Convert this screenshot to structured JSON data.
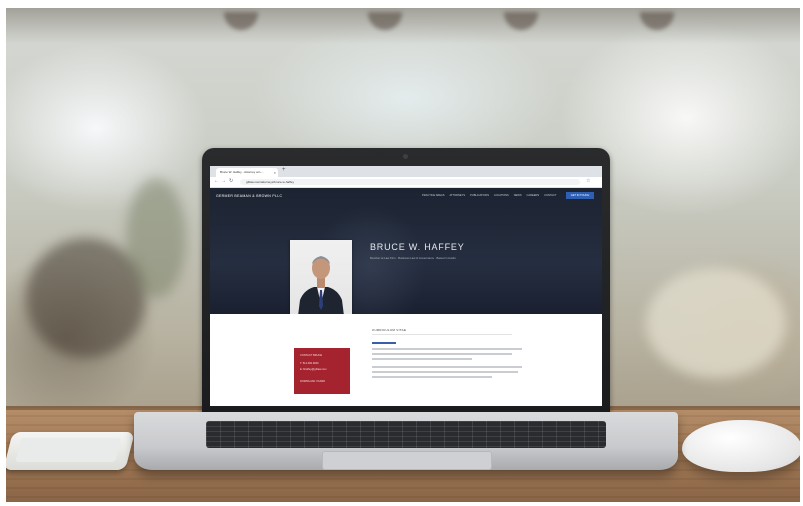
{
  "browser": {
    "tab_title": "Bruce W. Haffey - Attorney at L...",
    "tab_close": "×",
    "new_tab": "+",
    "nav_back": "←",
    "nav_forward": "→",
    "nav_reload": "↻",
    "url": "g3law.com/attorneys/bruce-w-haffey",
    "star": "☆"
  },
  "site": {
    "logo": "GERMER BEAMAN & BROWN PLLC",
    "menu": [
      "PRACTICE AREAS",
      "ATTORNEYS",
      "PUBLICATIONS",
      "LOCATIONS",
      "NEWS",
      "CAREERS",
      "CONTACT"
    ],
    "contact_button": "GET IN TOUCH",
    "hero": {
      "name": "BRUCE W. HAFFEY",
      "subtitle": "Member at Law Firm · Business Law & Governance · Based in Austin"
    },
    "section_title": "CURRICULUM VITAE",
    "card": {
      "lines": [
        "CONTACT BRUCE",
        "T: 512.482.9000",
        "E: bhaffey@g3law.com",
        "DOWNLOAD VCARD"
      ]
    }
  },
  "colors": {
    "hero_bg": "#1c2331",
    "accent_blue": "#2f5fb3",
    "card_red": "#a4232f"
  }
}
